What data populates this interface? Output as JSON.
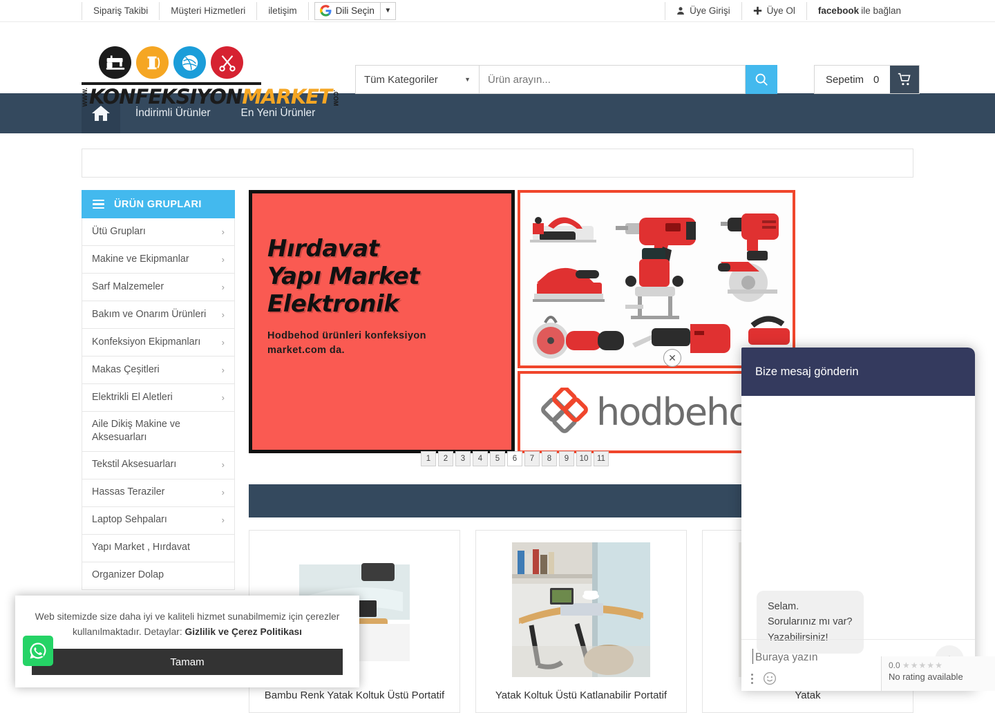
{
  "topbar": {
    "left_items": [
      {
        "label": "Sipariş Takibi"
      },
      {
        "label": "Müşteri Hizmetleri"
      },
      {
        "label": "iletişim"
      }
    ],
    "language": {
      "label": "Dili Seçin",
      "icon": "google-g-icon",
      "caret": "▼"
    },
    "right_items": [
      {
        "label": "Üye Girişi",
        "icon": "user-icon"
      },
      {
        "label": "Üye Ol",
        "icon": "plus-icon"
      }
    ],
    "facebook": {
      "brand": "facebook",
      "rest": " ile bağlan"
    }
  },
  "logo": {
    "www": "WWW.",
    "part1": "KONFEKSIYON",
    "part2": "MARKET",
    "com": ".COM",
    "icons": [
      "sewing-machine-icon",
      "thread-spool-icon",
      "yarn-ball-icon",
      "scissors-icon"
    ]
  },
  "search": {
    "category_selected": "Tüm Kategoriler",
    "placeholder": "Ürün arayın...",
    "value": "",
    "button_icon": "search-icon"
  },
  "cart": {
    "label": "Sepetim",
    "count": "0",
    "icon": "cart-icon"
  },
  "nav": {
    "home_icon": "home-icon",
    "items": [
      {
        "label": "İndirimli Ürünler"
      },
      {
        "label": "En Yeni Ürünler"
      }
    ]
  },
  "sidebar": {
    "title": "ÜRÜN GRUPLARI",
    "menu_icon": "hamburger-icon",
    "items": [
      {
        "label": "Ütü Grupları",
        "chevron": "›"
      },
      {
        "label": "Makine ve Ekipmanlar",
        "chevron": "›"
      },
      {
        "label": "Sarf Malzemeler",
        "chevron": "›"
      },
      {
        "label": "Bakım ve Onarım Ürünleri",
        "chevron": "›"
      },
      {
        "label": "Konfeksiyon Ekipmanları",
        "chevron": "›"
      },
      {
        "label": "Makas Çeşitleri",
        "chevron": "›"
      },
      {
        "label": "Elektrikli El Aletleri",
        "chevron": "›"
      },
      {
        "label": "Aile Dikiş Makine ve Aksesuarları",
        "chevron": ""
      },
      {
        "label": "Tekstil Aksesuarları",
        "chevron": "›"
      },
      {
        "label": "Hassas Teraziler",
        "chevron": "›"
      },
      {
        "label": "Laptop Sehpaları",
        "chevron": "›"
      },
      {
        "label": "Yapı Market , Hırdavat",
        "chevron": ""
      },
      {
        "label": "Organizer Dolap",
        "chevron": ""
      }
    ]
  },
  "slider": {
    "title_lines": [
      "Hırdavat",
      "Yapı Market",
      "Elektronik"
    ],
    "subtitle": "Hodbehod ürünleri konfeksiyon market.com da.",
    "brand_text": "hodbehod",
    "close_icon": "close-icon",
    "pagination": [
      "1",
      "2",
      "3",
      "4",
      "5",
      "6",
      "7",
      "8",
      "9",
      "10",
      "11"
    ],
    "active_page": "6"
  },
  "products": [
    {
      "title": "Bambu Renk Yatak Koltuk Üstü Portatif",
      "image": "bamboo-laptop-desk-image"
    },
    {
      "title": "Yatak Koltuk Üstü Katlanabilir Portatif",
      "image": "folding-laptop-desk-image"
    },
    {
      "title": "Yatak",
      "image": "laptop-desk-image"
    }
  ],
  "chat": {
    "header": "Bize mesaj gönderin",
    "message": "Selam.\nSorularınız mı var?\nYazabilirsiniz!",
    "input_placeholder": "Buraya yazın",
    "input_value": "",
    "send_icon": "send-arrow-icon",
    "emoji_icon": "emoji-icon",
    "menu_icon": "kebab-menu-icon",
    "rating_value": "0.0",
    "rating_stars": "★★★★★",
    "rating_text": "No rating available"
  },
  "cookie": {
    "text_before": "Web sitemizde size daha iyi ve kaliteli hizmet sunabilmemiz için çerezler kullanılmaktadır. Detaylar: ",
    "link": "Gizlilik ve Çerez Politikası",
    "button": "Tamam"
  },
  "whatsapp": {
    "icon": "whatsapp-icon"
  },
  "colors": {
    "accent_blue": "#43b9ee",
    "nav_dark": "#34495e",
    "banner_red": "#fa5a52",
    "border_red": "#f0462c",
    "chat_navy": "#343a5e",
    "whatsapp_green": "#25d366"
  }
}
